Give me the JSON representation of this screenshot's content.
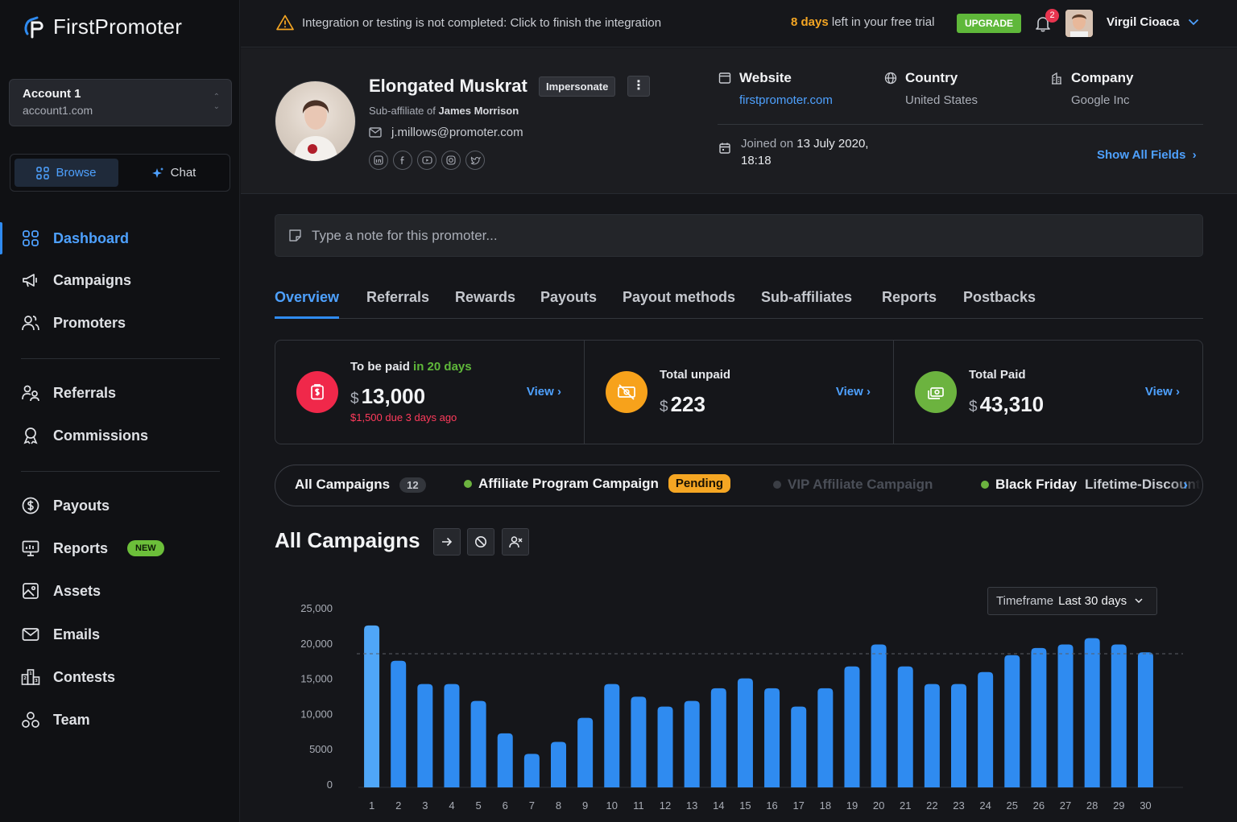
{
  "brand": {
    "name": "FirstPromoter",
    "accent": "#2f8bf0"
  },
  "account": {
    "name": "Account 1",
    "domain": "account1.com"
  },
  "mode_switch": {
    "browse": "Browse",
    "chat": "Chat"
  },
  "nav": {
    "dashboard": "Dashboard",
    "campaigns": "Campaigns",
    "promoters": "Promoters",
    "referrals": "Referrals",
    "commissions": "Commissions",
    "payouts": "Payouts",
    "reports": "Reports",
    "reports_badge": "NEW",
    "assets": "Assets",
    "emails": "Emails",
    "contests": "Contests",
    "team": "Team"
  },
  "topbar": {
    "warning": "Integration or testing is not completed: Click to finish the integration",
    "trial_days": "8 days",
    "trial_rest": " left in your free trial",
    "upgrade": "UPGRADE",
    "notifications": "2",
    "user": "Virgil Cioaca"
  },
  "promoter": {
    "name": "Elongated Muskrat",
    "impersonate": "Impersonate",
    "sub_prefix": "Sub-affiliate of ",
    "sub_parent": "James Morrison",
    "email": "j.millows@promoter.com",
    "website_label": "Website",
    "website": "firstpromoter.com",
    "country_label": "Country",
    "country": "United States",
    "company_label": "Company",
    "company": "Google Inc",
    "joined_prefix": "Joined on ",
    "joined_date": "13 July 2020,",
    "joined_time": "18:18",
    "show_all": "Show All Fields"
  },
  "note": {
    "placeholder": "Type a note for this promoter..."
  },
  "tabs": [
    "Overview",
    "Referrals",
    "Rewards",
    "Payouts",
    "Payout methods",
    "Sub-affiliates",
    "Reports",
    "Postbacks"
  ],
  "stats": {
    "to_be_paid": {
      "label": "To be paid",
      "label_hl": " in 20 days",
      "currency": "$",
      "value": "13,000",
      "due": "$1,500 due 3 days ago",
      "view": "View"
    },
    "total_unpaid": {
      "label": "Total unpaid",
      "currency": "$",
      "value": "223",
      "view": "View"
    },
    "total_paid": {
      "label": "Total Paid",
      "currency": "$",
      "value": "43,310",
      "view": "View"
    }
  },
  "campaigns_bar": {
    "all": "All Campaigns",
    "all_count": "12",
    "affiliate": "Affiliate Program Campaign",
    "affiliate_status": "Pending",
    "vip": "VIP Affiliate Campaign",
    "black_friday": "Black Friday",
    "lifetime": "Lifetime-Discount"
  },
  "section": {
    "title": "All Campaigns"
  },
  "timeframe": {
    "label": "Timeframe",
    "value": "Last 30 days"
  },
  "chart_data": {
    "type": "bar",
    "categories": [
      "1",
      "2",
      "3",
      "4",
      "5",
      "6",
      "7",
      "8",
      "9",
      "10",
      "11",
      "12",
      "13",
      "14",
      "15",
      "16",
      "17",
      "18",
      "19",
      "20",
      "21",
      "22",
      "23",
      "24",
      "25",
      "26",
      "27",
      "28",
      "29",
      "30"
    ],
    "values": [
      22500,
      17500,
      14200,
      14200,
      11800,
      7200,
      4300,
      6000,
      9400,
      14200,
      12400,
      11000,
      11800,
      13600,
      15000,
      13600,
      11000,
      13600,
      16700,
      19800,
      16700,
      14200,
      14200,
      15900,
      18300,
      19300,
      19800,
      20700,
      19800,
      18700
    ],
    "ylim": [
      0,
      25000
    ],
    "yticks": [
      "25,000",
      "20,000",
      "15,000",
      "10,000",
      "5000",
      "0"
    ],
    "reference_line": 18500,
    "bar_color": "#2f8bf0",
    "highlight_color": "#4fa6f7",
    "grid": false
  }
}
